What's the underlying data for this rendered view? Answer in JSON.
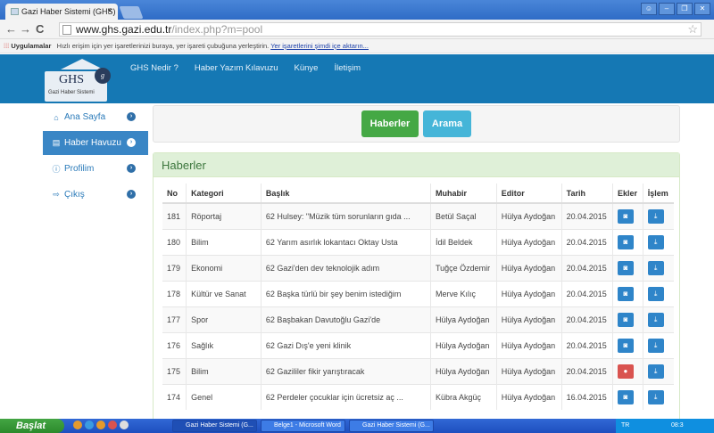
{
  "browser": {
    "tab_title": "Gazi Haber Sistemi (GHS)",
    "tab_close": "×",
    "url_host": "www.ghs.gazi.edu.tr",
    "url_path": "/index.php?m=pool",
    "bookmarks_apps": "Uygulamalar",
    "bookmarks_hint": "Hızlı erişim için yer işaretlerinizi buraya, yer işareti çubuğuna yerleştirin.",
    "bookmarks_link": "Yer işaretlerini şimdi içe aktarın..."
  },
  "site": {
    "logo_text": "GHS",
    "logo_sub": "Gazi Haber Sistemi",
    "nav": [
      "GHS Nedir ?",
      "Haber Yazım Kılavuzu",
      "Künye",
      "İletişim"
    ]
  },
  "sidebar": {
    "items": [
      {
        "label": "Ana Sayfa",
        "icon": "home-icon"
      },
      {
        "label": "Haber Havuzu",
        "icon": "list-icon"
      },
      {
        "label": "Profilim",
        "icon": "info-icon"
      },
      {
        "label": "Çıkış",
        "icon": "logout-icon"
      }
    ]
  },
  "actions": {
    "news_label": "Haberler",
    "search_label": "Arama"
  },
  "panel": {
    "title": "Haberler",
    "columns": [
      "No",
      "Kategori",
      "Başlık",
      "Muhabir",
      "Editor",
      "Tarih",
      "Ekler",
      "İşlem"
    ],
    "rows": [
      {
        "no": "181",
        "kategori": "Röportaj",
        "baslik": "62 Hulsey: \"Müzik tüm sorunların gıda ...",
        "muhabir": "Betül Saçal",
        "editor": "Hülya Aydoğan",
        "tarih": "20.04.2015",
        "ek": "camera"
      },
      {
        "no": "180",
        "kategori": "Bilim",
        "baslik": "62 Yarım asırlık lokantacı Oktay Usta",
        "muhabir": "İdil Beldek",
        "editor": "Hülya Aydoğan",
        "tarih": "20.04.2015",
        "ek": "camera"
      },
      {
        "no": "179",
        "kategori": "Ekonomi",
        "baslik": "62 Gazi'den dev teknolojik adım",
        "muhabir": "Tuğçe Özdemir",
        "editor": "Hülya Aydoğan",
        "tarih": "20.04.2015",
        "ek": "camera"
      },
      {
        "no": "178",
        "kategori": "Kültür ve Sanat",
        "baslik": "62 Başka türlü bir şey benim istediğim",
        "muhabir": "Merve Kılıç",
        "editor": "Hülya Aydoğan",
        "tarih": "20.04.2015",
        "ek": "camera"
      },
      {
        "no": "177",
        "kategori": "Spor",
        "baslik": "62 Başbakan Davutoğlu Gazi'de",
        "muhabir": "Hülya Aydoğan",
        "editor": "Hülya Aydoğan",
        "tarih": "20.04.2015",
        "ek": "camera"
      },
      {
        "no": "176",
        "kategori": "Sağlık",
        "baslik": "62 Gazi Dış'e yeni klinik",
        "muhabir": "Hülya Aydoğan",
        "editor": "Hülya Aydoğan",
        "tarih": "20.04.2015",
        "ek": "camera"
      },
      {
        "no": "175",
        "kategori": "Bilim",
        "baslik": "62 Gazililer fikir yarıştıracak",
        "muhabir": "Hülya Aydoğan",
        "editor": "Hülya Aydoğan",
        "tarih": "20.04.2015",
        "ek": "none"
      },
      {
        "no": "174",
        "kategori": "Genel",
        "baslik": "62 Perdeler çocuklar için ücretsiz aç ...",
        "muhabir": "Kübra Akgüç",
        "editor": "Hülya Aydoğan",
        "tarih": "16.04.2015",
        "ek": "camera"
      }
    ]
  },
  "taskbar": {
    "start_label": "Başlat",
    "tasks": [
      "Gazi Haber Sistemi (G...",
      "Belge1 - Microsoft Word",
      "Gazi Haber Sistemi (G..."
    ],
    "tray_lang": "TR",
    "tray_time": "08:3"
  },
  "colors": {
    "header_blue": "#1578b4",
    "active_sidebar": "#3a86c5",
    "green_button": "#45a845",
    "blue_button": "#45b5d8",
    "panel_head": "#dff0d8"
  }
}
